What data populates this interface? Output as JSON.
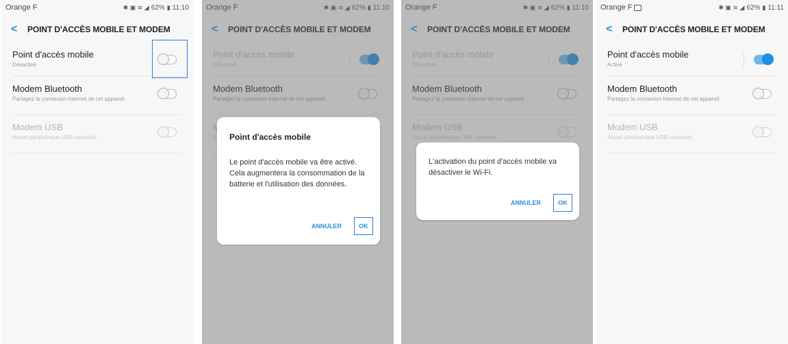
{
  "status": {
    "carrier": "Orange F",
    "battery": "62%",
    "time_a": "11:10",
    "time_b": "11:11"
  },
  "appbar": {
    "title": "POINT D'ACCÈS MOBILE ET MODEM"
  },
  "settings": {
    "hotspot_title": "Point d'accès mobile",
    "hotspot_off": "Désactivé",
    "hotspot_on": "Activé",
    "bt_title": "Modem Bluetooth",
    "bt_sub": "Partagez la connexion Internet de cet appareil.",
    "usb_title": "Modem USB",
    "usb_sub": "Aucun périphérique USB connecté."
  },
  "dialog1": {
    "title": "Point d'accès mobile",
    "body": "Le point d'accès mobile va être activé. Cela augmentera la consommation de la batterie et l'utilisation des données.",
    "cancel": "ANNULER",
    "ok": "OK"
  },
  "dialog2": {
    "body": "L'activation du point d'accès mobile va désactiver le Wi-Fi.",
    "cancel": "ANNULER",
    "ok": "OK"
  },
  "colors": {
    "accent": "#2b8fd6",
    "highlight": "#2f78d8",
    "switch_on": "#1f8fe0"
  }
}
